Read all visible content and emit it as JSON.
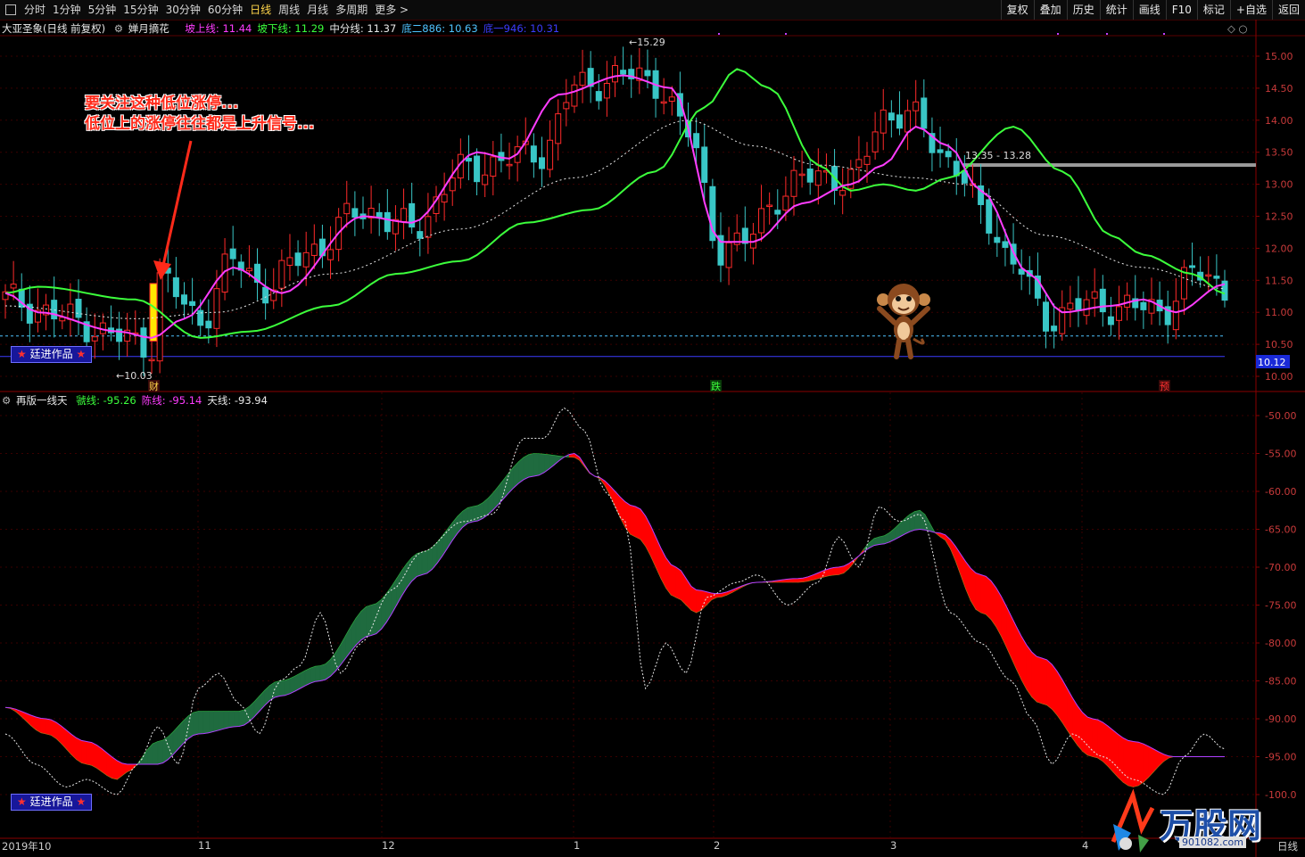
{
  "toolbar": {
    "periods": [
      "分时",
      "1分钟",
      "5分钟",
      "15分钟",
      "30分钟",
      "60分钟",
      "日线",
      "周线",
      "月线",
      "多周期",
      "更多 >"
    ],
    "active_period": "日线",
    "right_buttons": [
      "复权",
      "叠加",
      "历史",
      "统计",
      "画线",
      "F10",
      "标记",
      "+自选",
      "返回"
    ]
  },
  "main_chart": {
    "stock_name": "大亚圣象(日线 前复权)",
    "indicator_name": "婵月摘花",
    "lines": [
      {
        "label": "坡上线: 11.44",
        "color": "#ff3cff"
      },
      {
        "label": "坡下线: 11.29",
        "color": "#3cff3c"
      },
      {
        "label": "中分线: 11.37",
        "color": "#e8e8e8"
      },
      {
        "label": "底二886: 10.63",
        "color": "#4fc3ff"
      },
      {
        "label": "底一946: 10.31",
        "color": "#3c3cff"
      }
    ],
    "price_axis": [
      "15.00",
      "14.50",
      "14.00",
      "13.50",
      "13.00",
      "12.50",
      "12.00",
      "11.50",
      "11.00",
      "10.50",
      "10.00"
    ],
    "price_range": [
      10.0,
      15.0
    ],
    "max_label": "15.29",
    "min_label": "10.03",
    "range_label": "13.35 - 13.28",
    "last_price": "10.12",
    "event_markers": [
      "财",
      "跌",
      "预"
    ]
  },
  "annotation": {
    "line1": "要关注这种低位涨停...",
    "line2": "低位上的涨停往往都是上升信号..."
  },
  "sub_chart": {
    "indicator_name": "再版一线天",
    "lines": [
      {
        "label": "虢线: -95.26",
        "color": "#3cff3c"
      },
      {
        "label": "陈线: -95.14",
        "color": "#ff3cff"
      },
      {
        "label": "天线: -93.94",
        "color": "#e8e8e8"
      }
    ],
    "value_axis": [
      "-50.00",
      "-55.00",
      "-60.00",
      "-65.00",
      "-70.00",
      "-75.00",
      "-80.00",
      "-85.00",
      "-90.00",
      "-95.00",
      "-100.0"
    ],
    "value_range": [
      -100,
      -50
    ]
  },
  "badges": {
    "top": "廷进作品",
    "bottom": "廷进作品"
  },
  "time_axis": [
    "2019年10",
    "11",
    "12",
    "1",
    "2",
    "3",
    "4"
  ],
  "watermark": {
    "brand": "万股网",
    "url": "901082.com"
  },
  "colors": {
    "up": "#ff2a2a",
    "down": "#39c6c6",
    "fill_up": "#ff0000",
    "fill_down": "#1f6b3f",
    "grid": "#5a0000"
  }
}
